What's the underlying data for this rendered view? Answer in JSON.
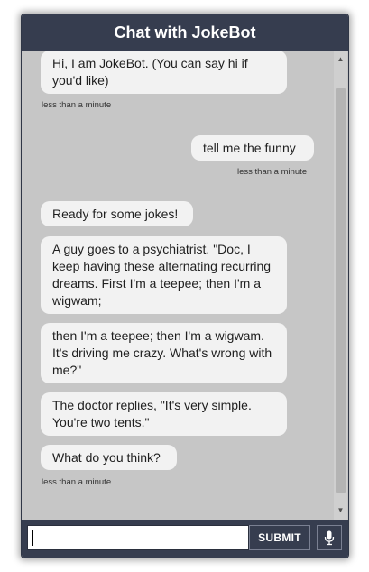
{
  "header": {
    "title": "Chat with JokeBot"
  },
  "messages": [
    {
      "from": "bot",
      "text": "Hi, I am JokeBot. (You can say hi if you'd like)"
    },
    {
      "from": "bot_timestamp",
      "text": "less than a minute"
    },
    {
      "from": "user",
      "text": "tell me the funny"
    },
    {
      "from": "user_timestamp",
      "text": "less than a minute"
    },
    {
      "from": "bot",
      "text": "Ready for some jokes!"
    },
    {
      "from": "bot",
      "text": "A guy goes to a psychiatrist. \"Doc, I keep having these alternating recurring dreams. First I'm a teepee; then I'm a wigwam;"
    },
    {
      "from": "bot",
      "text": "then I'm a teepee; then I'm a wigwam. It's driving me crazy. What's wrong with me?\""
    },
    {
      "from": "bot",
      "text": "The doctor replies, \"It's very simple. You're two tents.\""
    },
    {
      "from": "bot",
      "text": "What do you think?"
    },
    {
      "from": "bot_timestamp",
      "text": "less than a minute"
    }
  ],
  "input": {
    "value": "",
    "placeholder": ""
  },
  "footer": {
    "submit_label": "SUBMIT",
    "mic_icon": "microphone-icon"
  },
  "colors": {
    "header_bg": "#363d4f",
    "chat_bg": "#c6c6c6",
    "bubble_bg": "#f2f2f2"
  }
}
